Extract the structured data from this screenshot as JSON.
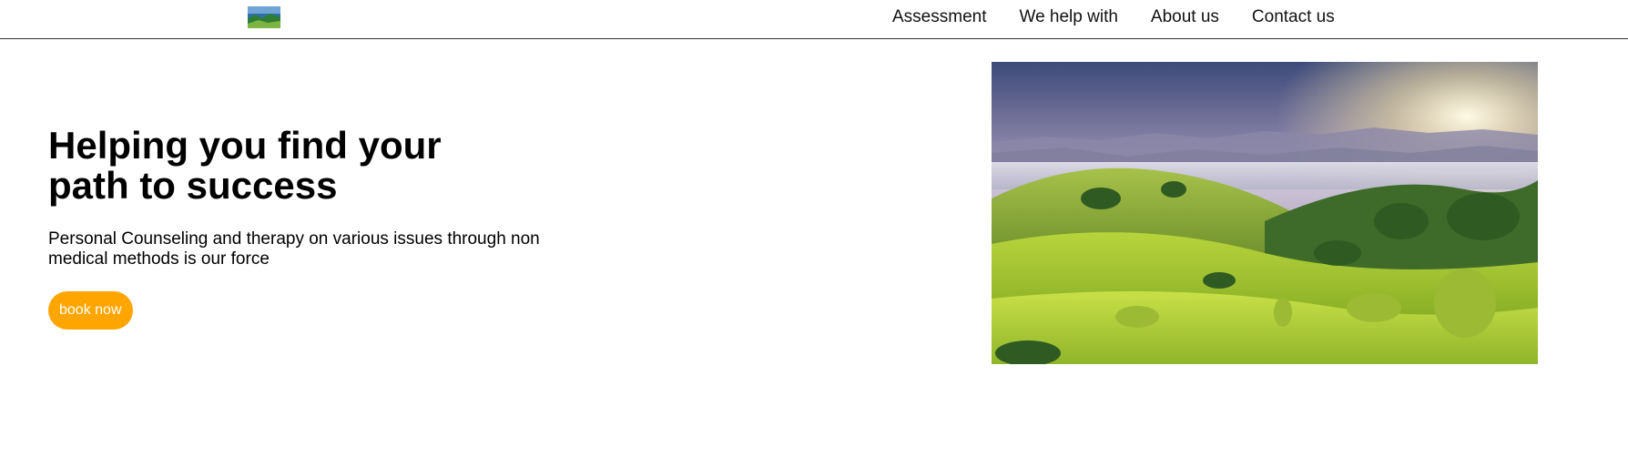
{
  "header": {
    "logo_icon": "landscape-thumbnail-icon",
    "nav": [
      {
        "label": "Assessment"
      },
      {
        "label": "We help with"
      },
      {
        "label": "About us"
      },
      {
        "label": "Contact us"
      }
    ]
  },
  "hero": {
    "title": "Helping you find your path to success",
    "subtitle": "Personal Counseling and therapy on various issues through non medical methods is our force",
    "cta_label": "book now",
    "image_icon": "landscape-hills-image"
  },
  "colors": {
    "accent": "#ffa500",
    "text": "#000000",
    "divider": "#333333"
  }
}
